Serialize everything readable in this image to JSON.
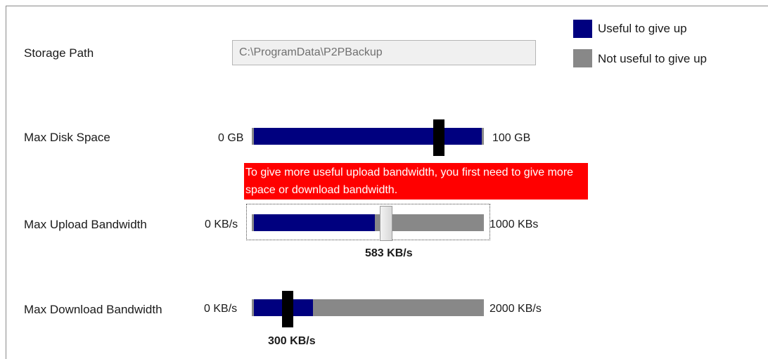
{
  "storage": {
    "label": "Storage Path",
    "path_value": "C:\\ProgramData\\P2PBackup"
  },
  "legend": {
    "useful": {
      "label": "Useful to give up",
      "color": "#00007f"
    },
    "not_useful": {
      "label": "Not useful to give up",
      "color": "#888888"
    }
  },
  "disk": {
    "label": "Max Disk Space",
    "min_label": "0 GB",
    "max_label": "100 GB",
    "value_fraction": 0.81
  },
  "warning": {
    "text": "To give more useful upload bandwidth, you first need to give more space or download bandwidth.",
    "color": "#ff0000"
  },
  "upload": {
    "label": "Max Upload Bandwidth",
    "min_label": "0 KB/s",
    "max_label": "1000 KBs",
    "value_label": "583 KB/s",
    "value": 583,
    "max": 1000,
    "useful_fraction": 0.53
  },
  "download": {
    "label": "Max Download Bandwidth",
    "min_label": "0 KB/s",
    "max_label": "2000 KB/s",
    "value_label": "300 KB/s",
    "value": 300,
    "max": 2000,
    "useful_fraction": 0.26
  }
}
